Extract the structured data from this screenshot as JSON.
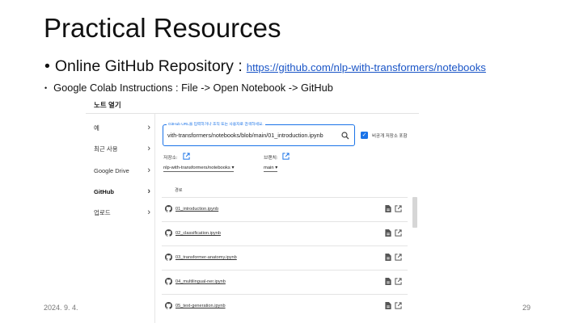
{
  "slide": {
    "title": "Practical Resources",
    "bullet1_label": "Online GitHub Repository :",
    "bullet1_link": "https://github.com/nlp-with-transformers/notebooks",
    "bullet2": "Google Colab Instructions : File -> Open Notebook -> GitHub",
    "footer_date": "2024. 9. 4.",
    "page_number": "29",
    "colors": {
      "link": "#1a55c7",
      "accent": "#1a73e8"
    }
  },
  "dialog": {
    "title": "노트 열기",
    "nav": [
      {
        "label": "예",
        "icon": "chevron-right-icon"
      },
      {
        "label": "최근 사용",
        "icon": "chevron-right-icon"
      },
      {
        "label": "Google Drive",
        "icon": "chevron-right-icon"
      },
      {
        "label": "GitHub",
        "icon": "chevron-right-icon",
        "active": true
      },
      {
        "label": "업로드",
        "icon": "chevron-right-icon"
      }
    ],
    "url_legend": "GitHub URL을 입력하거나 조직 또는 사용자로 검색하세요.",
    "url_value": "vith-transformers/notebooks/blob/main/01_introduction.ipynb",
    "include_private_label": "비공개 저장소 포함",
    "include_private_checked": true,
    "repo_label": "저장소:",
    "repo_value": "nlp-with-transformers/notebooks",
    "branch_label": "브랜치:",
    "branch_value": "main",
    "path_header": "경로",
    "files": [
      "01_introduction.ipynb",
      "02_classification.ipynb",
      "03_transformer-anatomy.ipynb",
      "04_multilingual-ner.ipynb",
      "05_text-generation.ipynb"
    ]
  }
}
